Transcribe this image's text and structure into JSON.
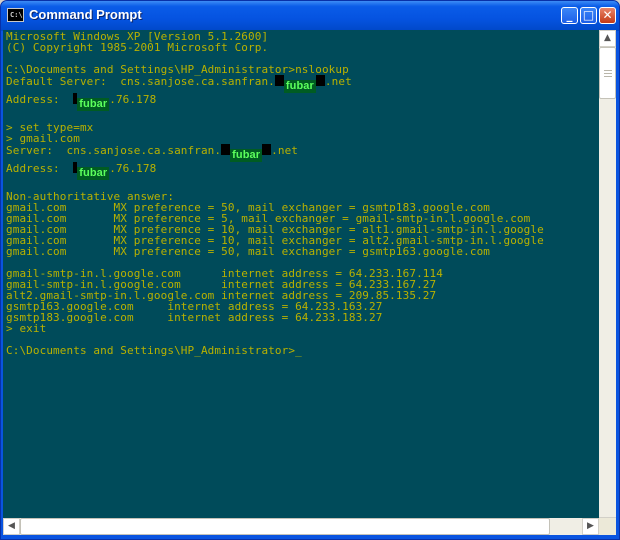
{
  "window": {
    "title": "Command Prompt",
    "icon_text": "C:\\",
    "buttons": {
      "minimize": "_",
      "maximize": "□",
      "close": "✕"
    }
  },
  "console": {
    "l1": "Microsoft Windows XP [Version 5.1.2600]",
    "l2": "(C) Copyright 1985-2001 Microsoft Corp.",
    "l3": "",
    "l4": "C:\\Documents and Settings\\HP_Administrator>nslookup",
    "l5a": "Default Server:  cns.sanjose.ca.sanfran.",
    "l5b": "fubar",
    "l5c": ".net",
    "l6a": "Address:  ",
    "l6b": "fubar",
    "l6c": ".76.178",
    "l7": "",
    "l8": "> set type=mx",
    "l9": "> gmail.com",
    "l10a": "Server:  cns.sanjose.ca.sanfran.",
    "l10b": "fubar",
    "l10c": ".net",
    "l11a": "Address:  ",
    "l11b": "fubar",
    "l11c": ".76.178",
    "l12": "",
    "l13": "Non-authoritative answer:",
    "l14": "gmail.com       MX preference = 50, mail exchanger = gsmtp183.google.com",
    "l15": "gmail.com       MX preference = 5, mail exchanger = gmail-smtp-in.l.google.com",
    "l16": "gmail.com       MX preference = 10, mail exchanger = alt1.gmail-smtp-in.l.google",
    "l17": "gmail.com       MX preference = 10, mail exchanger = alt2.gmail-smtp-in.l.google",
    "l18": "gmail.com       MX preference = 50, mail exchanger = gsmtp163.google.com",
    "l19": "",
    "l20": "gmail-smtp-in.l.google.com      internet address = 64.233.167.114",
    "l21": "gmail-smtp-in.l.google.com      internet address = 64.233.167.27",
    "l22": "alt2.gmail-smtp-in.l.google.com internet address = 209.85.135.27",
    "l23": "gsmtp163.google.com     internet address = 64.233.163.27",
    "l24": "gsmtp183.google.com     internet address = 64.233.183.27",
    "l25": "> exit",
    "l26": "",
    "l27": "C:\\Documents and Settings\\HP_Administrator>",
    "cursor": "_"
  },
  "scrollbar": {
    "up": "▲",
    "down": "▼",
    "left": "◀",
    "right": "▶"
  }
}
